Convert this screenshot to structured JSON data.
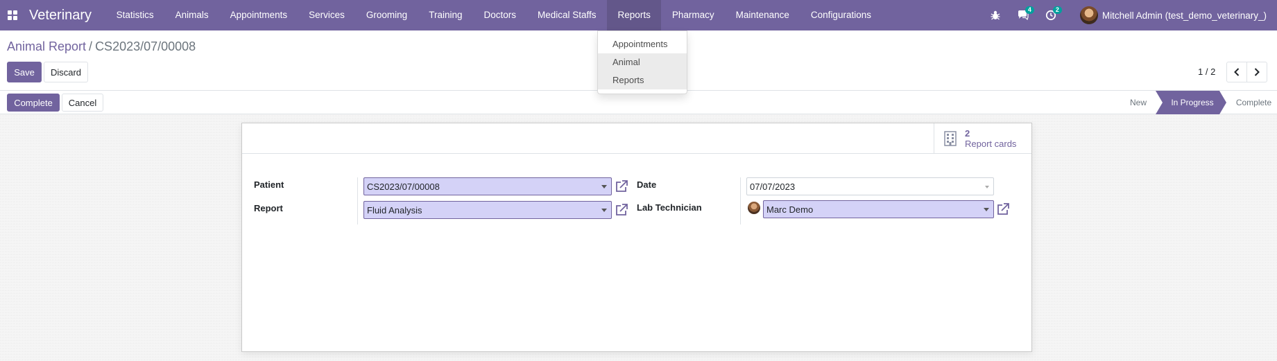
{
  "app": {
    "brand": "Veterinary"
  },
  "nav": {
    "menu": [
      "Statistics",
      "Animals",
      "Appointments",
      "Services",
      "Grooming",
      "Training",
      "Doctors",
      "Medical Staffs",
      "Reports",
      "Pharmacy",
      "Maintenance",
      "Configurations"
    ],
    "active": "Reports",
    "messages_count": "4",
    "activities_count": "2",
    "user_name": "Mitchell Admin (test_demo_veterinary_)"
  },
  "dropdown": {
    "items": [
      "Appointments",
      "Animal Reports"
    ],
    "hovered": "Animal Reports"
  },
  "breadcrumb": {
    "parent": "Animal Report",
    "separator": "/",
    "current": "CS2023/07/00008"
  },
  "buttons": {
    "save": "Save",
    "discard": "Discard",
    "complete": "Complete",
    "cancel": "Cancel"
  },
  "pager": {
    "value": "1 / 2"
  },
  "statusbar": {
    "stages": [
      "New",
      "In Progress",
      "Complete"
    ],
    "current": "In Progress"
  },
  "smart_button": {
    "count": "2",
    "label": "Report cards"
  },
  "form": {
    "patient_label": "Patient",
    "patient_value": "CS2023/07/00008",
    "report_label": "Report",
    "report_value": "Fluid Analysis",
    "date_label": "Date",
    "date_value": "07/07/2023",
    "tech_label": "Lab Technician",
    "tech_value": "Marc Demo"
  },
  "colors": {
    "brand": "#71639e",
    "badge": "#00a09d",
    "many2one_bg": "#d4d2f7"
  },
  "icons": [
    "apps-grid-icon",
    "bug-icon",
    "chat-icon",
    "clock-icon",
    "chevron-left-icon",
    "chevron-right-icon",
    "building-icon",
    "external-link-icon"
  ]
}
